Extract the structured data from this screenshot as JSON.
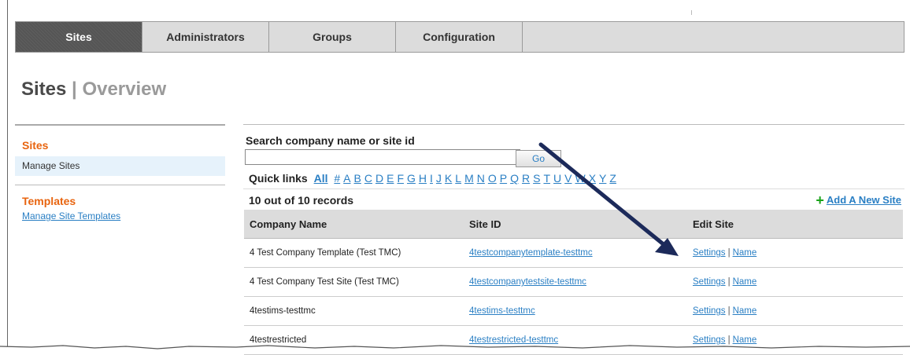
{
  "tabs": [
    {
      "label": "Sites",
      "active": true
    },
    {
      "label": "Administrators",
      "active": false
    },
    {
      "label": "Groups",
      "active": false
    },
    {
      "label": "Configuration",
      "active": false
    }
  ],
  "page": {
    "title": "Sites",
    "title_separator": "|",
    "subtitle": "Overview"
  },
  "sidebar": {
    "section1": {
      "heading": "Sites",
      "item": "Manage Sites"
    },
    "section2": {
      "heading": "Templates",
      "link": "Manage Site Templates"
    }
  },
  "search": {
    "label": "Search company name or site id",
    "input_value": "",
    "go_label": "Go",
    "quick_links_label": "Quick links",
    "all_label": "All",
    "letters": [
      "#",
      "A",
      "B",
      "C",
      "D",
      "E",
      "F",
      "G",
      "H",
      "I",
      "J",
      "K",
      "L",
      "M",
      "N",
      "O",
      "P",
      "Q",
      "R",
      "S",
      "T",
      "U",
      "V",
      "W",
      "X",
      "Y",
      "Z"
    ]
  },
  "records": {
    "count_text": "10 out of 10 records",
    "add_label": "Add A New Site"
  },
  "table": {
    "headers": [
      "Company Name",
      "Site ID",
      "Edit Site"
    ],
    "rows": [
      {
        "company": "4 Test Company Template (Test TMC)",
        "site_id": "4testcompanytemplate-testtmc",
        "settings": "Settings",
        "name": "Name"
      },
      {
        "company": "4 Test Company Test Site (Test TMC)",
        "site_id": "4testcompanytestsite-testtmc",
        "settings": "Settings",
        "name": "Name"
      },
      {
        "company": "4testims-testtmc",
        "site_id": "4testims-testtmc",
        "settings": "Settings",
        "name": "Name"
      },
      {
        "company": "4testrestricted",
        "site_id": "4testrestricted-testtmc",
        "settings": "Settings",
        "name": "Name"
      }
    ]
  },
  "colors": {
    "accent_orange": "#e8640f",
    "link_blue": "#2a7fc4",
    "arrow_navy": "#1c2a5a",
    "add_green": "#19a319"
  }
}
